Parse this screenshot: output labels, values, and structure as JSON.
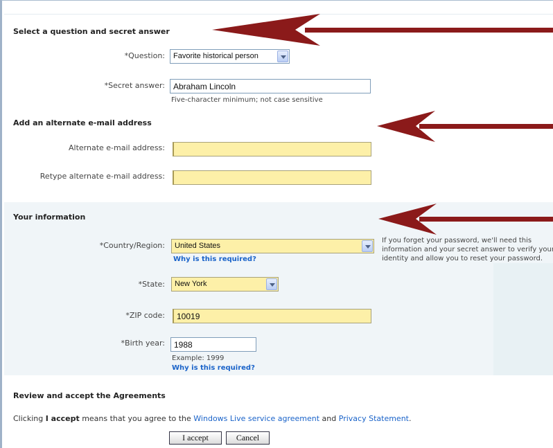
{
  "security": {
    "title": "Select a question and secret answer",
    "question_label": "*Question:",
    "question_value": "Favorite historical person",
    "answer_label": "*Secret answer:",
    "answer_value": "Abraham Lincoln",
    "answer_hint": "Five-character minimum; not case sensitive"
  },
  "alternate": {
    "title": "Add an alternate e-mail address",
    "email_label": "Alternate e-mail address:",
    "email_value": "",
    "retype_label": "Retype alternate e-mail address:",
    "retype_value": ""
  },
  "info": {
    "title": "Your information",
    "country_label": "*Country/Region:",
    "country_value": "United States",
    "country_link": "Why is this required?",
    "side_note": "If you forget your password, we'll need this information and your secret answer to verify your identity and allow you to reset your password.",
    "state_label": "*State:",
    "state_value": "New York",
    "zip_label": "*ZIP code:",
    "zip_value": "10019",
    "birth_label": "*Birth year:",
    "birth_value": "1988",
    "birth_example": "Example: 1999",
    "birth_link": "Why is this required?"
  },
  "agreements": {
    "title": "Review and accept the Agreements",
    "text_pre": "Clicking ",
    "text_bold": "I accept",
    "text_mid": " means that you agree to the ",
    "service_link": "Windows Live service agreement",
    "text_and": " and ",
    "privacy_link": "Privacy Statement",
    "text_end": ".",
    "accept_button": "I accept",
    "cancel_button": "Cancel"
  },
  "colors": {
    "arrow": "#8b1a1a",
    "highlight_field": "#fdf0a8",
    "link": "#1a63c9"
  },
  "icons": {
    "dropdown": "chevron-down-icon",
    "annotation": "red-arrow"
  }
}
